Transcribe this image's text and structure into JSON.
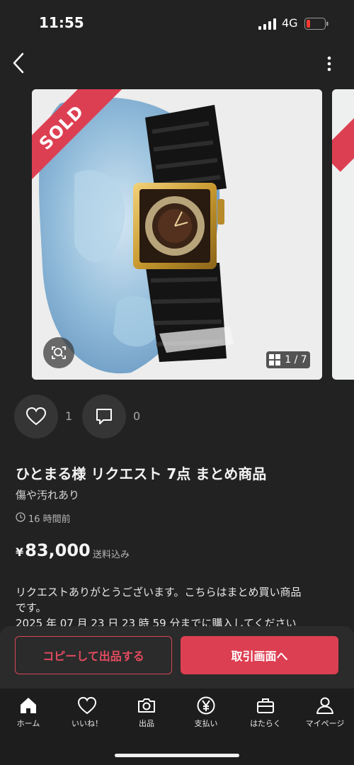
{
  "status_bar": {
    "time": "11:55",
    "network": "4G"
  },
  "product": {
    "sold_label": "SOLD",
    "image_counter": "1 / 7",
    "likes": "1",
    "comments": "0",
    "title": "ひとまる様 リクエスト 7点 まとめ商品",
    "condition": "傷や汚れあり",
    "posted": "16 時間前",
    "price_symbol": "¥",
    "price": "83,000",
    "shipping": "送料込み",
    "description": [
      "リクエストありがとうございます。こちらはまとめ買い商品",
      "です。",
      "2025 年 07 月 23 日 23 時 59 分までに購入してください"
    ]
  },
  "actions": {
    "copy_label": "コピーして出品する",
    "trade_label": "取引画面へ"
  },
  "tabs": [
    {
      "label": "ホーム",
      "icon": "home-icon"
    },
    {
      "label": "いいね！",
      "icon": "heart-icon"
    },
    {
      "label": "出品",
      "icon": "camera-icon"
    },
    {
      "label": "支払い",
      "icon": "yen-icon"
    },
    {
      "label": "はたらく",
      "icon": "briefcase-icon"
    },
    {
      "label": "マイページ",
      "icon": "person-icon"
    }
  ],
  "colors": {
    "accent": "#dd3f52",
    "background": "#222222"
  }
}
